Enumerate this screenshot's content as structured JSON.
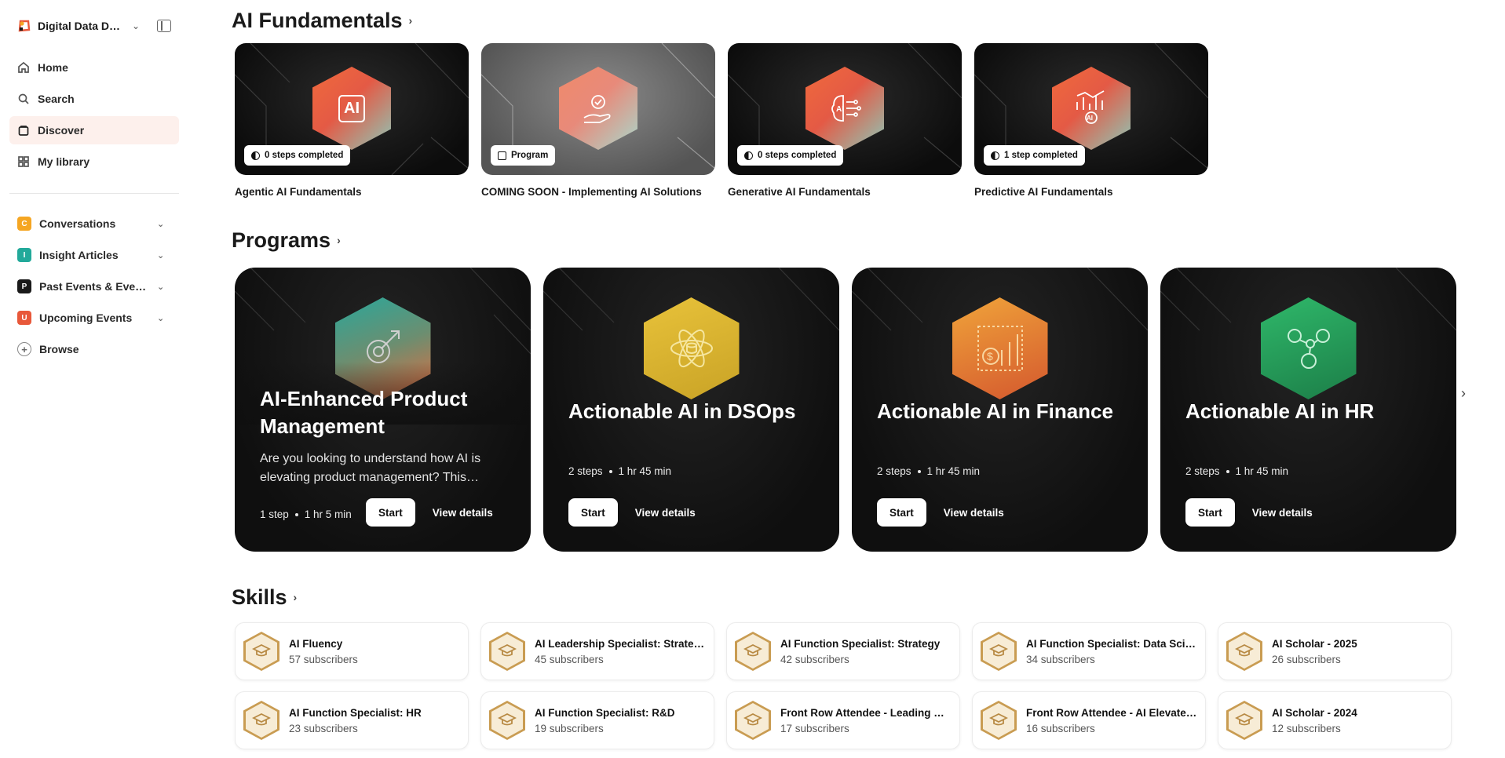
{
  "workspace": {
    "name": "Digital Data Design Institute"
  },
  "nav": [
    {
      "label": "Home",
      "icon": "home-icon"
    },
    {
      "label": "Search",
      "icon": "search-icon"
    },
    {
      "label": "Discover",
      "icon": "bag-icon",
      "active": true
    },
    {
      "label": "My library",
      "icon": "grid-icon"
    }
  ],
  "groups": [
    {
      "badge": "C",
      "color": "#f5a623",
      "label": "Conversations"
    },
    {
      "badge": "I",
      "color": "#22a99a",
      "label": "Insight Articles"
    },
    {
      "badge": "P",
      "color": "#1a1a1a",
      "label": "Past Events & Events Archive"
    },
    {
      "badge": "U",
      "color": "#e8583a",
      "label": "Upcoming Events"
    }
  ],
  "browse_label": "Browse",
  "fundamentals": {
    "title": "AI Fundamentals",
    "items": [
      {
        "pill": "0 steps completed",
        "title": "Agentic AI Fundamentals",
        "icon": "ai-chip-icon"
      },
      {
        "pill": "Program",
        "title": "COMING SOON - Implementing AI Solutions",
        "icon": "hand-gear-icon"
      },
      {
        "pill": "0 steps completed",
        "title": "Generative AI Fundamentals",
        "icon": "ai-brain-icon"
      },
      {
        "pill": "1 step completed",
        "title": "Predictive AI Fundamentals",
        "icon": "ai-chart-icon"
      }
    ]
  },
  "programs": {
    "title": "Programs",
    "items": [
      {
        "title": "AI-Enhanced Product Management",
        "desc": "Are you looking to understand how AI is elevating product management? This program explores the tools and strategies",
        "steps": "1 step",
        "duration": "1 hr 5 min",
        "start": "Start",
        "view": "View details",
        "colors": [
          "#2aa79a",
          "#e86b3e"
        ]
      },
      {
        "title": "Actionable AI in DSOps",
        "steps": "2 steps",
        "duration": "1 hr 45 min",
        "start": "Start",
        "view": "View details",
        "colors": [
          "#e8c23a",
          "#c9a326"
        ]
      },
      {
        "title": "Actionable AI in Finance",
        "steps": "2 steps",
        "duration": "1 hr 45 min",
        "start": "Start",
        "view": "View details",
        "colors": [
          "#f0a43a",
          "#d4582e"
        ]
      },
      {
        "title": "Actionable AI in HR",
        "steps": "2 steps",
        "duration": "1 hr 45 min",
        "start": "Start",
        "view": "View details",
        "colors": [
          "#2fb86a",
          "#1c7e48"
        ]
      }
    ]
  },
  "skills": {
    "title": "Skills",
    "items": [
      {
        "name": "AI Fluency",
        "subs": "57 subscribers"
      },
      {
        "name": "AI Leadership Specialist: Strategy",
        "subs": "45 subscribers"
      },
      {
        "name": "AI Function Specialist: Strategy",
        "subs": "42 subscribers"
      },
      {
        "name": "AI Function Specialist: Data Science",
        "subs": "34 subscribers"
      },
      {
        "name": "AI Scholar - 2025",
        "subs": "26 subscribers"
      },
      {
        "name": "AI Function Specialist: HR",
        "subs": "23 subscribers"
      },
      {
        "name": "AI Function Specialist: R&D",
        "subs": "19 subscribers"
      },
      {
        "name": "Front Row Attendee - Leading with AI",
        "subs": "17 subscribers"
      },
      {
        "name": "Front Row Attendee - AI Elevated Leadership",
        "subs": "16 subscribers"
      },
      {
        "name": "AI Scholar - 2024",
        "subs": "12 subscribers"
      }
    ]
  }
}
